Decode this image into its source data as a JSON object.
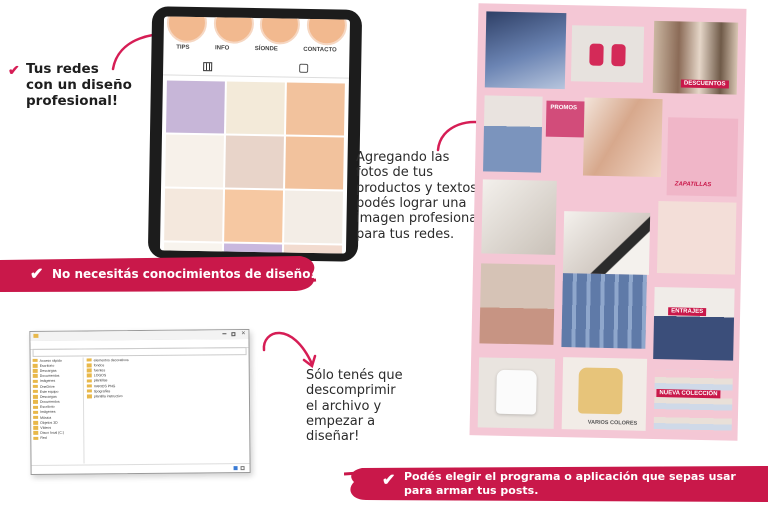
{
  "callouts": {
    "top_left": "Tus redes\ncon un diseño\nprofesional!",
    "middle": "Agregando las\nfotos de tus\nproductos y textos\npodés lograr una\nimagen profesional\npara tus redes.",
    "bottom": "Sólo tenés que\ndescomprimir\nel archivo y\nempezar a\ndiseñar!"
  },
  "banners": {
    "design_knowledge": "No necesitás conocimientos de diseño.",
    "choose_program": "Podés elegir el programa o aplicación que sepas usar\npara armar tus posts."
  },
  "tablet": {
    "tabs": [
      "TIPS",
      "INFO",
      "SÍONDE",
      "CONTACTO"
    ],
    "feed_colors": [
      "#c7b6d8",
      "#f3ead9",
      "#f2c29d",
      "#f7f1ea",
      "#e8d4c9",
      "#f2c29d",
      "#f4e8dd",
      "#f6c8a2",
      "#f3ede6",
      "#f8f4ee",
      "#c9b8de",
      "#f2dbcf"
    ]
  },
  "collage": {
    "labels": {
      "promos": "PROMOS",
      "nueva_coleccion": "NUEVA COLECCIÓN",
      "varios_colores": "VARIOS COLORES",
      "zapatillas": "ZAPATILLAS",
      "descuentos": "DESCUENTOS",
      "entrajes": "ENTRAJES"
    }
  },
  "explorer": {
    "sidebar": [
      "Acceso rápido",
      "Escritorio",
      "Descargas",
      "Documentos",
      "Imágenes",
      "OneDrive",
      "Este equipo",
      "Descargas",
      "Documentos",
      "Escritorio",
      "Imágenes",
      "Música",
      "Objetos 3D",
      "Vídeos",
      "Disco local (C:)",
      "Red"
    ],
    "files": [
      "elementos decorativos",
      "fondos",
      "fuentes",
      "LOGOS",
      "plantillas",
      "VARIOS PNG",
      "tipografías",
      "plantilla instructivo"
    ]
  }
}
